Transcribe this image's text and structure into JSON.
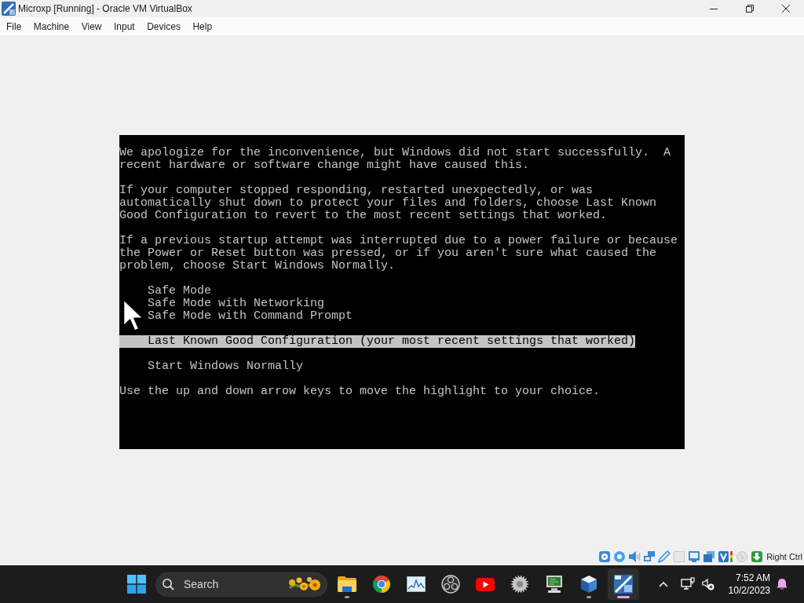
{
  "window": {
    "title": "Microxp [Running] - Oracle VM VirtualBox"
  },
  "menu": [
    "File",
    "Machine",
    "View",
    "Input",
    "Devices",
    "Help"
  ],
  "screen": {
    "paragraphs": [
      "We apologize for the inconvenience, but Windows did not start successfully.  A\nrecent hardware or software change might have caused this.",
      "If your computer stopped responding, restarted unexpectedly, or was\nautomatically shut down to protect your files and folders, choose Last Known\nGood Configuration to revert to the most recent settings that worked.",
      "If a previous startup attempt was interrupted due to a power failure or because\nthe Power or Reset button was pressed, or if you aren't sure what caused the\nproblem, choose Start Windows Normally."
    ],
    "option_groups": [
      {
        "options": [
          {
            "label": "Safe Mode",
            "selected": false
          },
          {
            "label": "Safe Mode with Networking",
            "selected": false
          },
          {
            "label": "Safe Mode with Command Prompt",
            "selected": false
          }
        ]
      },
      {
        "options": [
          {
            "label": "Last Known Good Configuration (your most recent settings that worked)",
            "selected": true
          }
        ]
      },
      {
        "options": [
          {
            "label": "Start Windows Normally",
            "selected": false
          }
        ]
      }
    ],
    "footer": "Use the up and down arrow keys to move the highlight to your choice."
  },
  "status_bar": {
    "host_key": "Right Ctrl"
  },
  "taskbar": {
    "search": {
      "placeholder": "Search"
    },
    "apps": [
      {
        "kind": "folder",
        "running": true,
        "selected": false
      },
      {
        "kind": "circle",
        "running": false,
        "selected": false
      },
      {
        "kind": "chart",
        "running": false,
        "selected": false
      },
      {
        "kind": "aperture",
        "running": false,
        "selected": false
      },
      {
        "kind": "play",
        "running": false,
        "selected": false
      },
      {
        "kind": "gear",
        "running": false,
        "selected": false
      },
      {
        "kind": "monitor",
        "running": false,
        "selected": false
      },
      {
        "kind": "cube",
        "running": true,
        "selected": false
      },
      {
        "kind": "tile",
        "running": true,
        "selected": true
      }
    ],
    "clock": {
      "time": "7:52 AM",
      "date": "10/2/2023"
    }
  }
}
